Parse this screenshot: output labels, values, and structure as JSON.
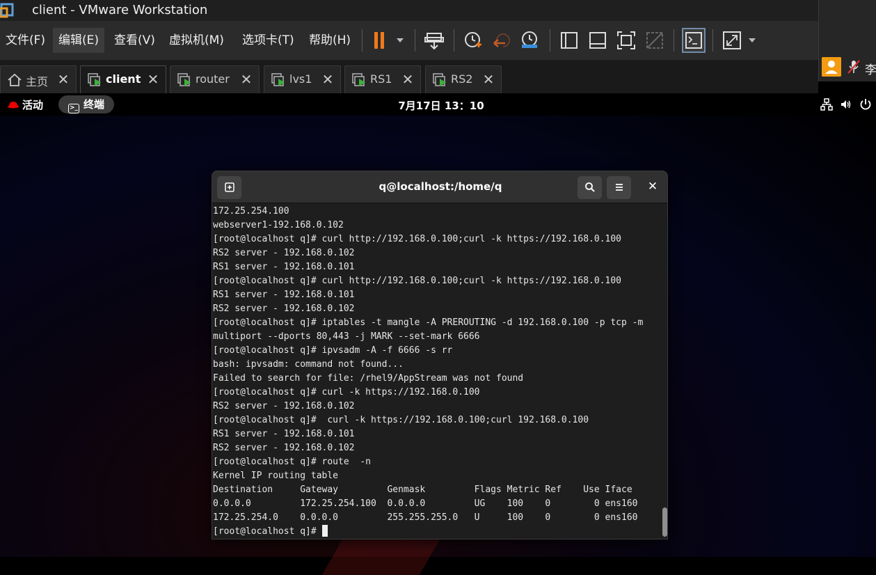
{
  "window": {
    "title": "client - VMware Workstation"
  },
  "menu": {
    "items": [
      {
        "label": "文件(F)"
      },
      {
        "label": "编辑(E)"
      },
      {
        "label": "查看(V)"
      },
      {
        "label": "虚拟机(M)"
      },
      {
        "label": "选项卡(T)"
      },
      {
        "label": "帮助(H)"
      }
    ]
  },
  "tabs": [
    {
      "label": "主页",
      "icon": "home-icon"
    },
    {
      "label": "client",
      "icon": "vm-icon"
    },
    {
      "label": "router",
      "icon": "vm-icon"
    },
    {
      "label": "lvs1",
      "icon": "vm-icon"
    },
    {
      "label": "RS1",
      "icon": "vm-icon"
    },
    {
      "label": "RS2",
      "icon": "vm-icon"
    }
  ],
  "side_panel": {
    "user_initial": "李"
  },
  "gnome": {
    "activities": "活动",
    "app": "终端",
    "clock": "7月17日  13：10"
  },
  "terminal": {
    "title": "q@localhost:/home/q",
    "lines": [
      "172.25.254.100",
      "webserver1-192.168.0.102",
      "[root@localhost q]# curl http://192.168.0.100;curl -k https://192.168.0.100",
      "RS2 server - 192.168.0.102",
      "RS1 server - 192.168.0.101",
      "[root@localhost q]# curl http://192.168.0.100;curl -k https://192.168.0.100",
      "RS1 server - 192.168.0.101",
      "RS2 server - 192.168.0.102",
      "[root@localhost q]# iptables -t mangle -A PREROUTING -d 192.168.0.100 -p tcp -m",
      "multiport --dports 80,443 -j MARK --set-mark 6666",
      "[root@localhost q]# ipvsadm -A -f 6666 -s rr",
      "bash: ipvsadm: command not found...",
      "Failed to search for file: /rhel9/AppStream was not found",
      "[root@localhost q]# curl -k https://192.168.0.100",
      "RS2 server - 192.168.0.102",
      "[root@localhost q]#  curl -k https://192.168.0.100;curl 192.168.0.100",
      "RS1 server - 192.168.0.101",
      "RS2 server - 192.168.0.102",
      "[root@localhost q]# route  -n",
      "Kernel IP routing table",
      "Destination     Gateway         Genmask         Flags Metric Ref    Use Iface",
      "0.0.0.0         172.25.254.100  0.0.0.0         UG    100    0        0 ens160",
      "172.25.254.0    0.0.0.0         255.255.255.0   U     100    0        0 ens160"
    ],
    "prompt": "[root@localhost q]# "
  },
  "colors": {
    "pause_accent": "#f07a1a",
    "vm_green": "#3db03d",
    "user_badge": "#f39c12"
  }
}
